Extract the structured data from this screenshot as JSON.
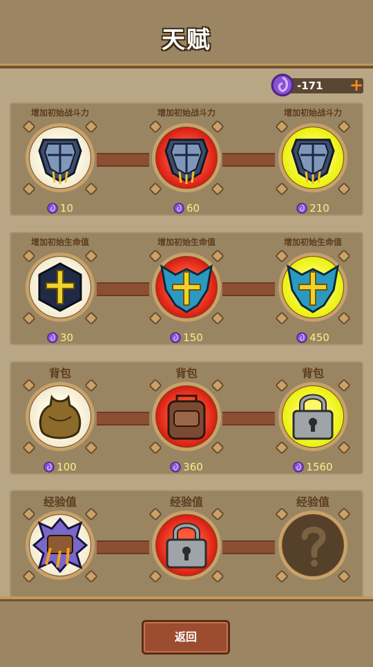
{
  "header": {
    "title": "天赋"
  },
  "currency": {
    "amount": "-171",
    "add_label": "+"
  },
  "colors": {
    "gem": "#8a52d6",
    "cost_text": "#f7f08a",
    "tier1": "white",
    "tier2": "red",
    "tier3": "yellow"
  },
  "rows": [
    {
      "nodes": [
        {
          "label": "增加初始战斗力",
          "cost": "10",
          "icon": "shield-icon"
        },
        {
          "label": "增加初始战斗力",
          "cost": "60",
          "icon": "shield-icon"
        },
        {
          "label": "增加初始战斗力",
          "cost": "210",
          "icon": "shield-icon"
        }
      ]
    },
    {
      "nodes": [
        {
          "label": "增加初始生命值",
          "cost": "30",
          "icon": "holy-cross-icon"
        },
        {
          "label": "增加初始生命值",
          "cost": "150",
          "icon": "holy-cross-icon"
        },
        {
          "label": "增加初始生命值",
          "cost": "450",
          "icon": "holy-cross-icon"
        }
      ]
    },
    {
      "nodes": [
        {
          "label": "背包",
          "cost": "100",
          "icon": "bag-icon"
        },
        {
          "label": "背包",
          "cost": "360",
          "icon": "bag-icon"
        },
        {
          "label": "背包",
          "cost": "1560",
          "icon": "padlock-icon"
        }
      ]
    },
    {
      "nodes": [
        {
          "label": "经验值",
          "cost": "",
          "icon": "scroll-icon"
        },
        {
          "label": "经验值",
          "cost": "",
          "icon": "padlock-icon"
        },
        {
          "label": "经验值",
          "cost": "",
          "icon": "question-mark-icon"
        }
      ]
    }
  ],
  "footer": {
    "back_label": "返回"
  }
}
